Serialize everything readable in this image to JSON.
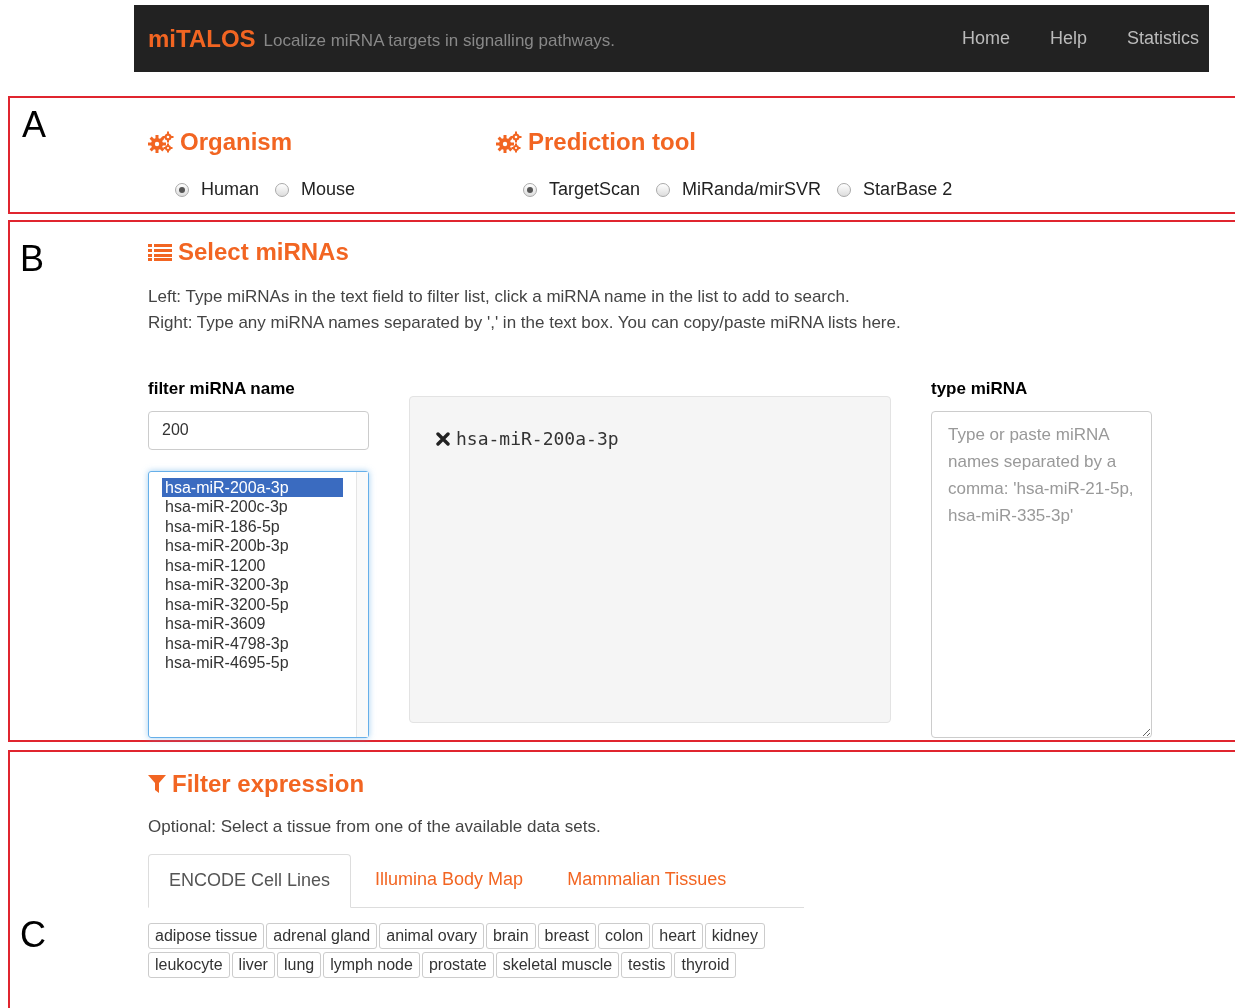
{
  "navbar": {
    "brand": "miTALOS",
    "tagline": "Localize miRNA targets in signalling pathways.",
    "links": [
      "Home",
      "Help",
      "Statistics"
    ]
  },
  "panel_a": {
    "panel_label": "A",
    "organism": {
      "title": "Organism",
      "options": [
        {
          "label": "Human",
          "selected": true
        },
        {
          "label": "Mouse",
          "selected": false
        }
      ]
    },
    "prediction_tool": {
      "title": "Prediction tool",
      "options": [
        {
          "label": "TargetScan",
          "selected": true
        },
        {
          "label": "MiRanda/mirSVR",
          "selected": false
        },
        {
          "label": "StarBase 2",
          "selected": false
        }
      ]
    }
  },
  "panel_b": {
    "panel_label": "B",
    "title": "Select miRNAs",
    "instructions": [
      "Left: Type miRNAs in the text field to filter list, click a miRNA name in the list to add to search.",
      "Right: Type any miRNA names separated by ',' in the text box. You can copy/paste miRNA lists here."
    ],
    "filter": {
      "label": "filter miRNA name",
      "value": "200",
      "list": [
        {
          "label": "hsa-miR-200a-3p",
          "selected": true
        },
        {
          "label": "hsa-miR-200c-3p",
          "selected": false
        },
        {
          "label": "hsa-miR-186-5p",
          "selected": false
        },
        {
          "label": "hsa-miR-200b-3p",
          "selected": false
        },
        {
          "label": "hsa-miR-1200",
          "selected": false
        },
        {
          "label": "hsa-miR-3200-3p",
          "selected": false
        },
        {
          "label": "hsa-miR-3200-5p",
          "selected": false
        },
        {
          "label": "hsa-miR-3609",
          "selected": false
        },
        {
          "label": "hsa-miR-4798-3p",
          "selected": false
        },
        {
          "label": "hsa-miR-4695-5p",
          "selected": false
        }
      ]
    },
    "selected_mirnas": [
      "hsa-miR-200a-3p"
    ],
    "type_mirna": {
      "label": "type miRNA",
      "placeholder": "Type or paste miRNA names separated by a comma: 'hsa-miR-21-5p, hsa-miR-335-3p'"
    }
  },
  "panel_c": {
    "panel_label": "C",
    "title": "Filter expression",
    "note": "Optional: Select a tissue from one of the available data sets.",
    "tabs": [
      {
        "label": "ENCODE Cell Lines",
        "selected": true
      },
      {
        "label": "Illumina Body Map",
        "selected": false
      },
      {
        "label": "Mammalian Tissues",
        "selected": false
      }
    ],
    "tissues": [
      [
        "adipose tissue",
        "adrenal gland",
        "animal ovary",
        "brain",
        "breast",
        "colon",
        "heart",
        "kidney"
      ],
      [
        "leukocyte",
        "liver",
        "lung",
        "lymph node",
        "prostate",
        "skeletal muscle",
        "testis",
        "thyroid"
      ]
    ]
  }
}
